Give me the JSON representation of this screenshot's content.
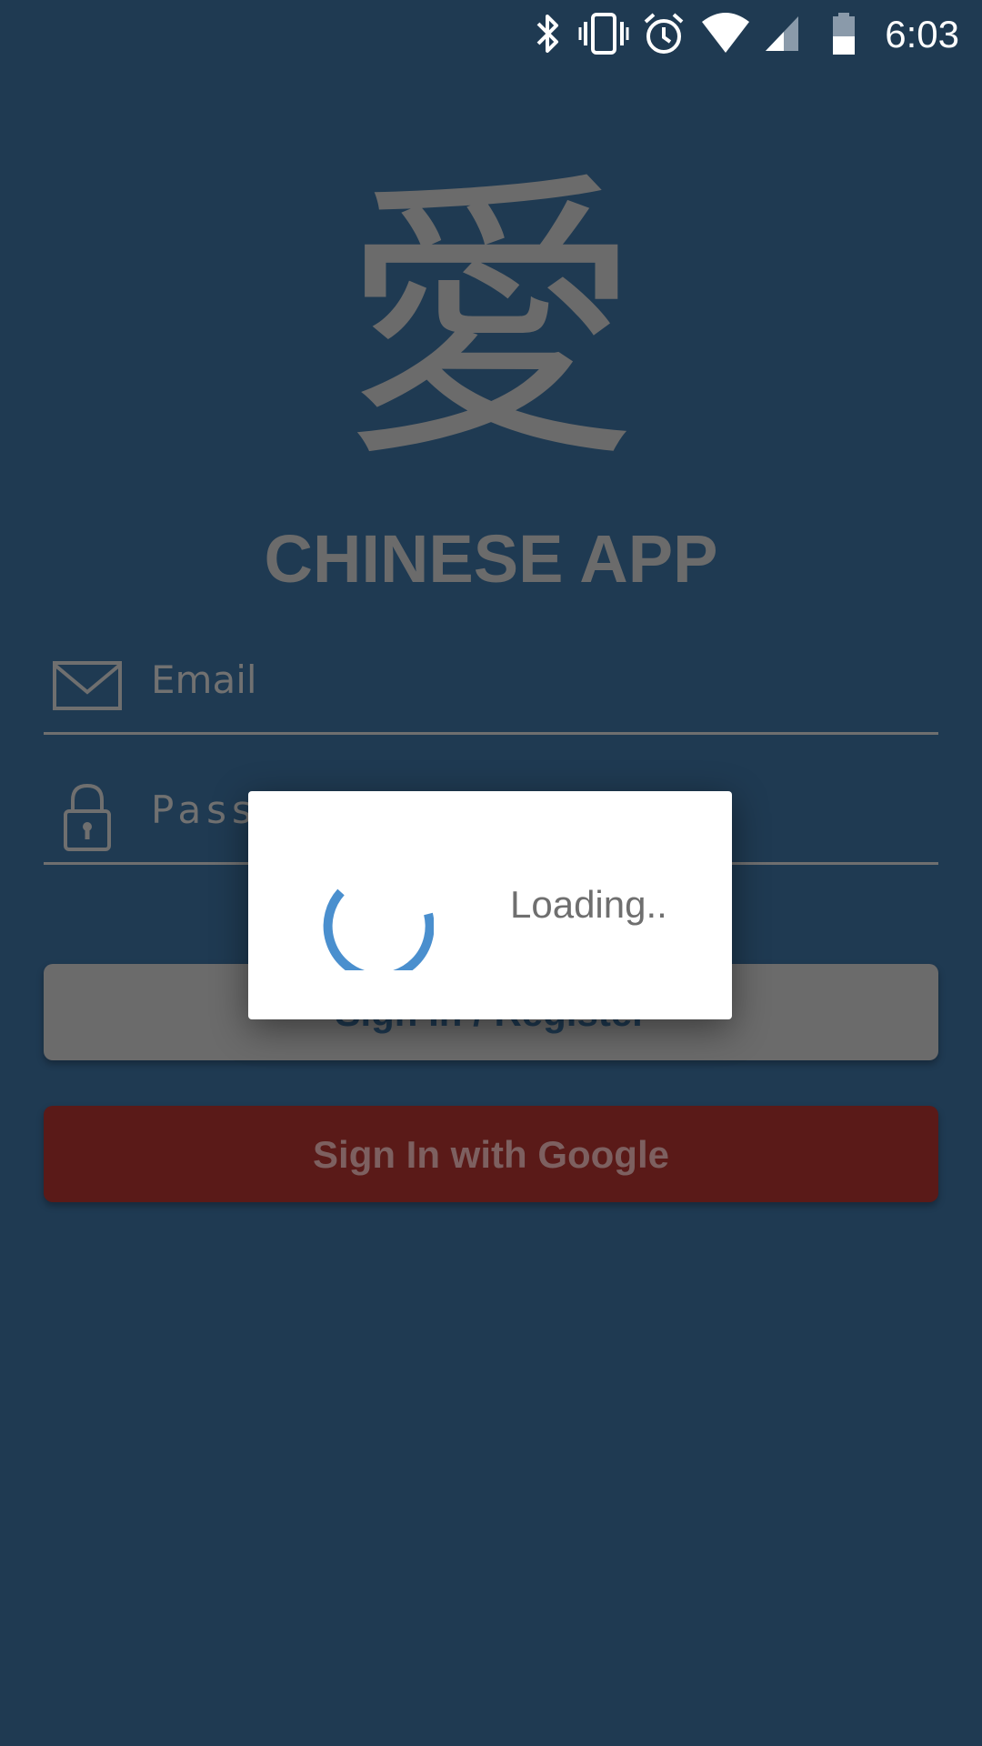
{
  "status_bar": {
    "time": "6:03",
    "icons": [
      "bluetooth-icon",
      "vibrate-icon",
      "alarm-icon",
      "wifi-icon",
      "cell-signal-icon",
      "battery-icon"
    ]
  },
  "logo": {
    "glyph": "愛"
  },
  "app_title": "CHINESE APP",
  "email_field": {
    "placeholder": "Email",
    "icon": "mail-icon"
  },
  "password_field": {
    "placeholder": "Password",
    "icon": "lock-icon"
  },
  "buttons": {
    "signin_register": "Sign In / Register",
    "google": "Sign In with Google"
  },
  "dialog": {
    "text": "Loading..",
    "spinner_color": "#4a8fce"
  },
  "colors": {
    "background": "#1f3a52",
    "muted_text": "#6b6b6b",
    "google_button": "#5a1a18"
  }
}
